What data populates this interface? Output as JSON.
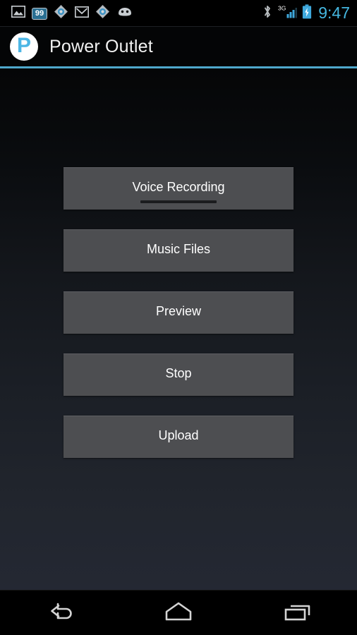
{
  "status_bar": {
    "notifications": [
      {
        "name": "image-icon",
        "label": "Image"
      },
      {
        "name": "notification-count-badge",
        "label": "99"
      },
      {
        "name": "blue-diamond-icon",
        "label": "Sync"
      },
      {
        "name": "gmail-icon",
        "label": "M"
      },
      {
        "name": "blue-diamond-icon-2",
        "label": "Sync"
      },
      {
        "name": "cyanogenmod-icon",
        "label": "CyanogenMod"
      }
    ],
    "badge_count": "99",
    "bluetooth": "Bluetooth",
    "network_type": "3G",
    "signal": "Signal",
    "battery": "Charging",
    "time": "9:47",
    "clock_color": "#45b7e0"
  },
  "action_bar": {
    "logo_letter": "P",
    "title": "Power Outlet",
    "accent_color": "#4ea8cc",
    "logo_color": "#4cb6e5"
  },
  "main": {
    "buttons": [
      {
        "label": "Voice Recording",
        "focused": true
      },
      {
        "label": "Music Files",
        "focused": false
      },
      {
        "label": "Preview",
        "focused": false
      },
      {
        "label": "Stop",
        "focused": false
      },
      {
        "label": "Upload",
        "focused": false
      }
    ],
    "button_color": "#4d4e51"
  },
  "nav_bar": {
    "back": "Back",
    "home": "Home",
    "recents": "Recent apps"
  }
}
